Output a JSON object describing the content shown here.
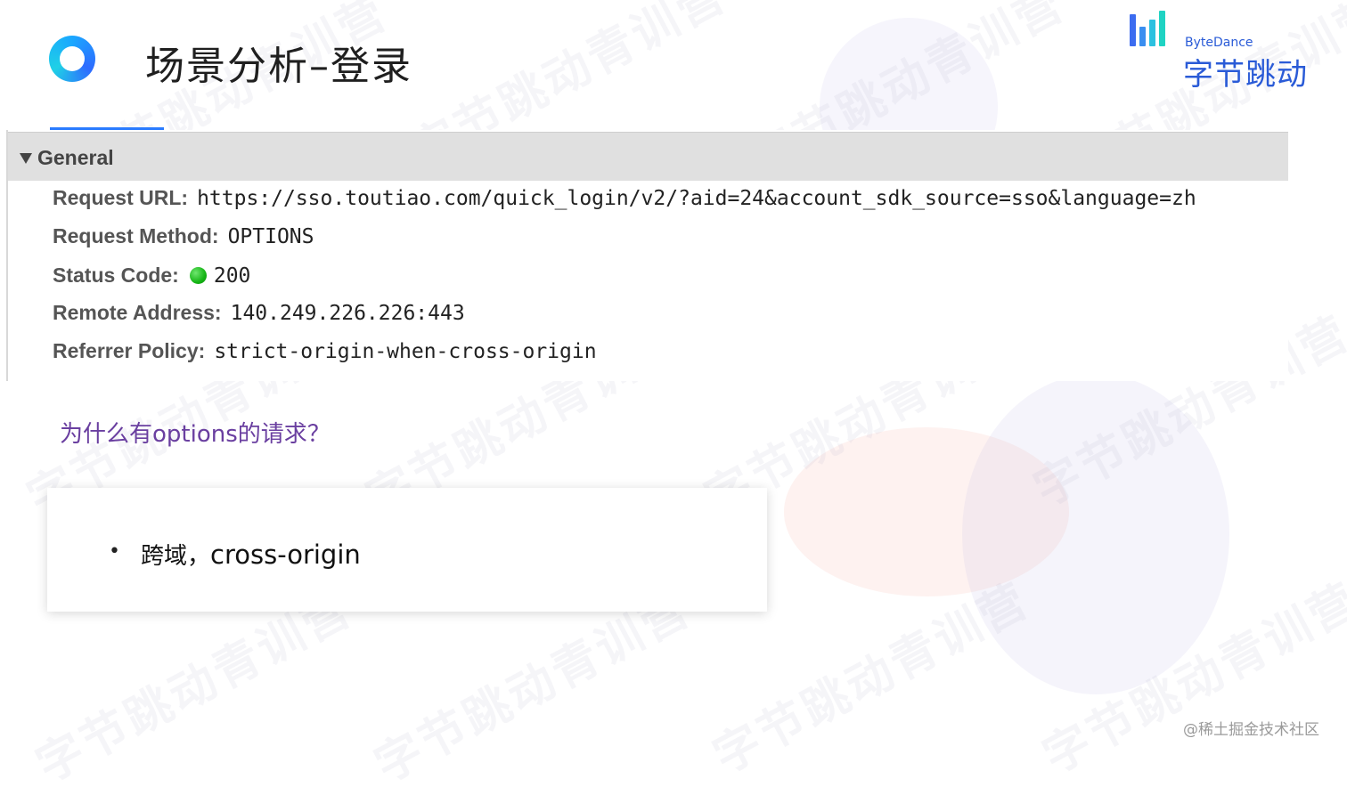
{
  "header": {
    "title": "场景分析–登录",
    "brand_en": "ByteDance",
    "brand_cn": "字节跳动"
  },
  "watermark_text": "字节跳动青训营",
  "general": {
    "section_label": "General",
    "rows": [
      {
        "key": "Request URL:",
        "value": "https://sso.toutiao.com/quick_login/v2/?aid=24&account_sdk_source=sso&language=zh"
      },
      {
        "key": "Request Method:",
        "value": "OPTIONS"
      },
      {
        "key": "Status Code:",
        "value": "200",
        "status_color": "#1db31d"
      },
      {
        "key": "Remote Address:",
        "value": "140.249.226.226:443"
      },
      {
        "key": "Referrer Policy:",
        "value": "strict-origin-when-cross-origin"
      }
    ]
  },
  "question": "为什么有options的请求？",
  "card": {
    "bullet": "•",
    "text_cn": "跨域，",
    "text_en": "cross-origin"
  },
  "footer": "@稀土掘金技术社区",
  "colors": {
    "accent": "#2a7bff",
    "question": "#6a3fa0",
    "brand": "#2a5bd7"
  }
}
